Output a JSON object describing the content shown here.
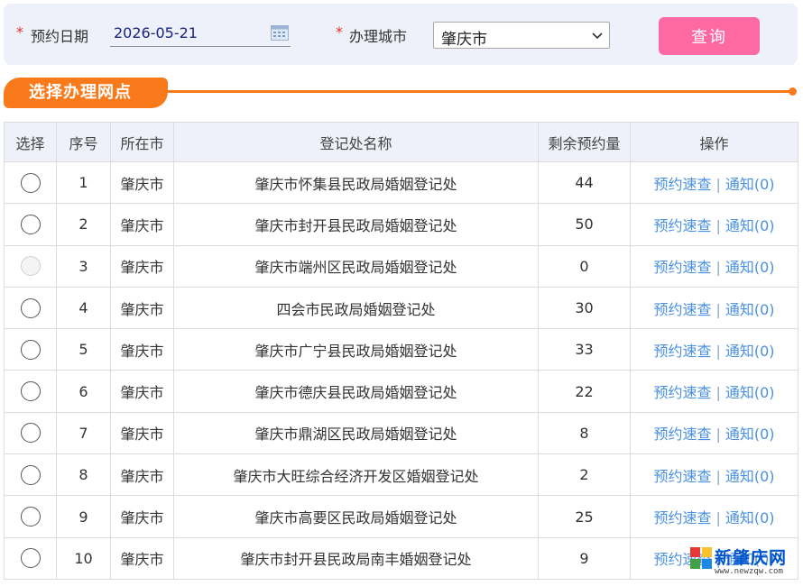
{
  "filter": {
    "required_mark": "*",
    "date_label": "预约日期",
    "date_value": "2026-05-21",
    "city_label": "办理城市",
    "city_value": "肇庆市",
    "query_label": "查询"
  },
  "section": {
    "title": "选择办理网点"
  },
  "table": {
    "headers": [
      "选择",
      "序号",
      "所在市",
      "登记处名称",
      "剩余预约量",
      "操作"
    ],
    "rows": [
      {
        "seq": "1",
        "city": "肇庆市",
        "name": "肇庆市怀集县民政局婚姻登记处",
        "remaining": "44",
        "selectable": true
      },
      {
        "seq": "2",
        "city": "肇庆市",
        "name": "肇庆市封开县民政局婚姻登记处",
        "remaining": "50",
        "selectable": true
      },
      {
        "seq": "3",
        "city": "肇庆市",
        "name": "肇庆市端州区民政局婚姻登记处",
        "remaining": "0",
        "selectable": false
      },
      {
        "seq": "4",
        "city": "肇庆市",
        "name": "四会市民政局婚姻登记处",
        "remaining": "30",
        "selectable": true
      },
      {
        "seq": "5",
        "city": "肇庆市",
        "name": "肇庆市广宁县民政局婚姻登记处",
        "remaining": "33",
        "selectable": true
      },
      {
        "seq": "6",
        "city": "肇庆市",
        "name": "肇庆市德庆县民政局婚姻登记处",
        "remaining": "22",
        "selectable": true
      },
      {
        "seq": "7",
        "city": "肇庆市",
        "name": "肇庆市鼎湖区民政局婚姻登记处",
        "remaining": "8",
        "selectable": true
      },
      {
        "seq": "8",
        "city": "肇庆市",
        "name": "肇庆市大旺综合经济开发区婚姻登记处",
        "remaining": "2",
        "selectable": true
      },
      {
        "seq": "9",
        "city": "肇庆市",
        "name": "肇庆市高要区民政局婚姻登记处",
        "remaining": "25",
        "selectable": true
      },
      {
        "seq": "10",
        "city": "肇庆市",
        "name": "肇庆市封开县民政局南丰婚姻登记处",
        "remaining": "9",
        "selectable": true
      }
    ],
    "op_quick": "预约速查",
    "op_sep": "|",
    "op_notice": "通知(0)"
  },
  "watermark": {
    "text": "新肇庆网",
    "url": "www.newzqw.com"
  },
  "colors": {
    "accent_orange": "#f97a1a",
    "query_pink": "#ff69a3",
    "remaining_green": "#0a8a0a",
    "remaining_red": "#d40000",
    "link_blue": "#4a90e2"
  },
  "icons": {
    "date": "calendar-icon",
    "select": "chevron-down-icon",
    "radio": "radio-button"
  }
}
